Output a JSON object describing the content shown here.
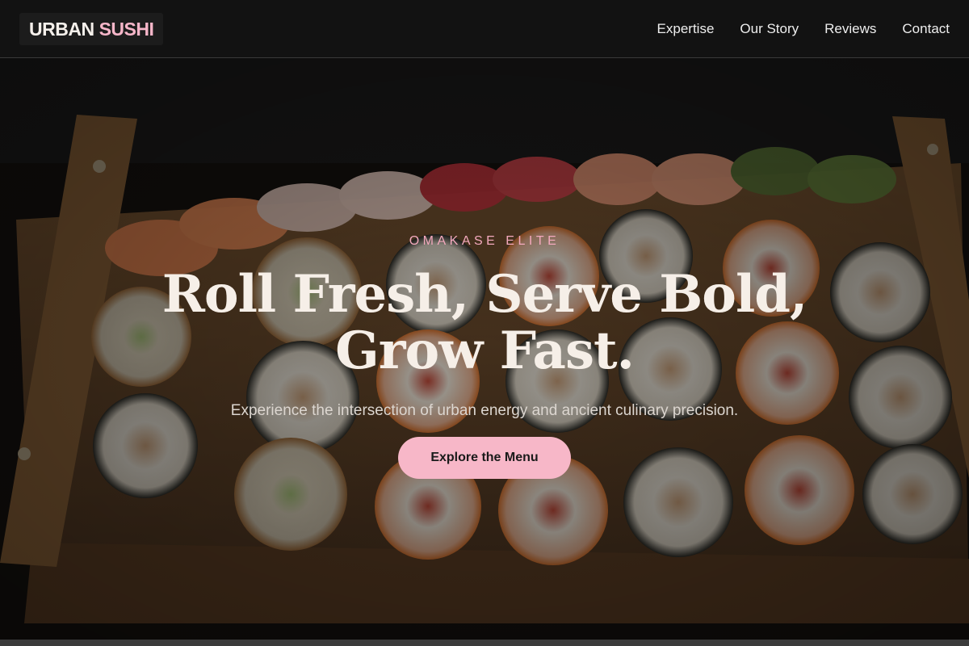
{
  "brand": {
    "word1": "URBAN",
    "word2": "SUSHI"
  },
  "nav": {
    "items": [
      "Expertise",
      "Our Story",
      "Reviews",
      "Contact"
    ]
  },
  "hero": {
    "eyebrow": "OMAKASE ELITE",
    "headline_line1": "Roll Fresh, Serve Bold,",
    "headline_line2": "Grow Fast.",
    "subtitle": "Experience the intersection of urban energy and ancient culinary precision.",
    "cta_label": "Explore the Menu"
  },
  "colors": {
    "accent_pink": "#f7b7c8",
    "nav_bg": "#121212",
    "headline": "#f6efe8"
  }
}
